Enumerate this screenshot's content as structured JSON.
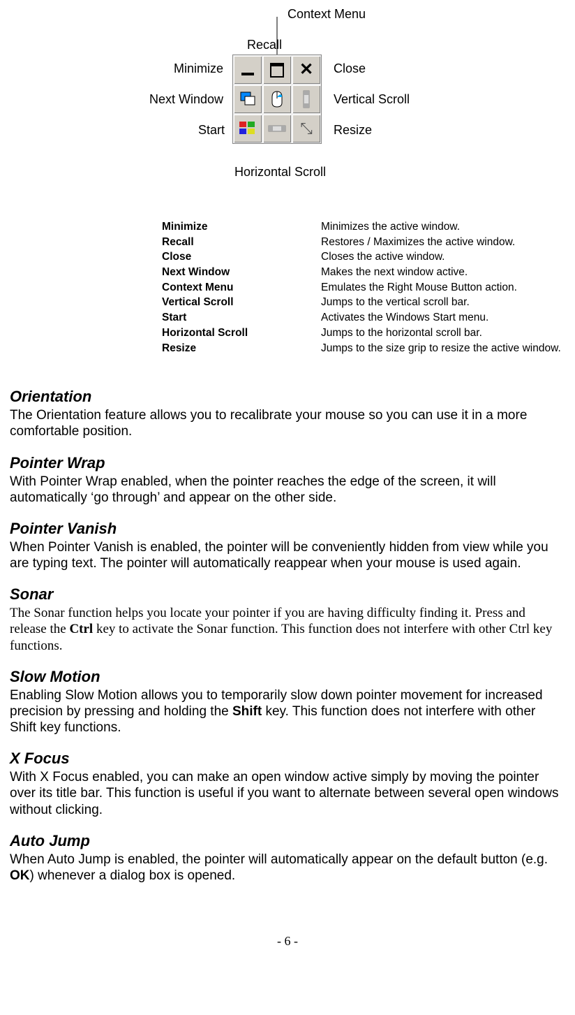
{
  "diagram": {
    "labels": {
      "context_menu": "Context Menu",
      "recall": "Recall",
      "minimize": "Minimize",
      "close": "Close",
      "next_window": "Next Window",
      "vertical_scroll": "Vertical Scroll",
      "start": "Start",
      "resize": "Resize",
      "horizontal_scroll": "Horizontal Scroll"
    }
  },
  "defs": [
    {
      "term": "Minimize",
      "desc": "Minimizes the active window."
    },
    {
      "term": "Recall",
      "desc": "Restores / Maximizes the active window."
    },
    {
      "term": "Close",
      "desc": "Closes the active window."
    },
    {
      "term": "Next Window",
      "desc": "Makes the next window active."
    },
    {
      "term": "Context Menu",
      "desc": "Emulates the Right Mouse Button action."
    },
    {
      "term": "Vertical Scroll",
      "desc": "Jumps to the vertical scroll bar."
    },
    {
      "term": "Start",
      "desc": "Activates the Windows Start menu."
    },
    {
      "term": "Horizontal Scroll",
      "desc": "Jumps to the horizontal scroll bar."
    },
    {
      "term": "Resize",
      "desc": "Jumps to the size grip to resize the active window."
    }
  ],
  "sections": {
    "orientation": {
      "title": "Orientation",
      "text": "The Orientation feature allows you to recalibrate your mouse so you can use it in a more comfortable position."
    },
    "pointer_wrap": {
      "title": "Pointer Wrap",
      "text": "With Pointer Wrap enabled, when the pointer reaches the edge of the screen, it will automatically ‘go through’ and appear on the other side."
    },
    "pointer_vanish": {
      "title": "Pointer Vanish",
      "text": "When Pointer Vanish is enabled, the pointer will be conveniently hidden from view while you are typing text.  The pointer will automatically reappear when your mouse is used again."
    },
    "sonar": {
      "title": "Sonar",
      "pre": "The Sonar function helps you locate your pointer if you are having difficulty finding it.  Press and release the ",
      "bold": "Ctrl",
      "post": " key to activate the Sonar function.  This function does not interfere with other Ctrl key functions."
    },
    "slow_motion": {
      "title": "Slow Motion",
      "pre": "Enabling Slow Motion allows you to temporarily slow down pointer movement for increased precision by pressing and holding the ",
      "bold": "Shift",
      "post": " key.  This function does not interfere with other Shift key functions."
    },
    "x_focus": {
      "title": "X Focus",
      "text": "With X Focus enabled, you can make an open window active simply by moving the pointer over its title bar.  This function is useful if you want to alternate between several open windows without clicking."
    },
    "auto_jump": {
      "title": "Auto Jump",
      "pre": "When Auto Jump is enabled, the pointer will automatically appear on the default button (e.g. ",
      "bold": "OK",
      "post": ") whenever a dialog box is opened."
    }
  },
  "footer": "- 6 -"
}
